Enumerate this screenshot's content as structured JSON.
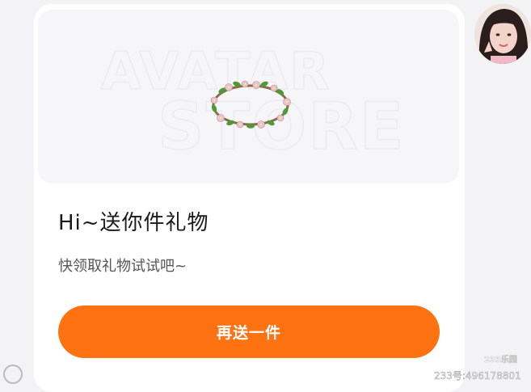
{
  "card": {
    "banner": {
      "watermark_top": "AVATAR",
      "watermark_bottom": "STORE",
      "gift_icon": "flower-wreath-icon"
    },
    "title": "Hi~送你件礼物",
    "subtitle": "快领取礼物试试吧~",
    "cta_label": "再送一件"
  },
  "avatar": {
    "icon": "user-avatar-girl"
  },
  "footer": {
    "logo_text": "233乐园",
    "user_id": "233号:496178801"
  },
  "colors": {
    "accent": "#ff7212",
    "background": "#f3f3f5",
    "card": "#ffffff"
  }
}
